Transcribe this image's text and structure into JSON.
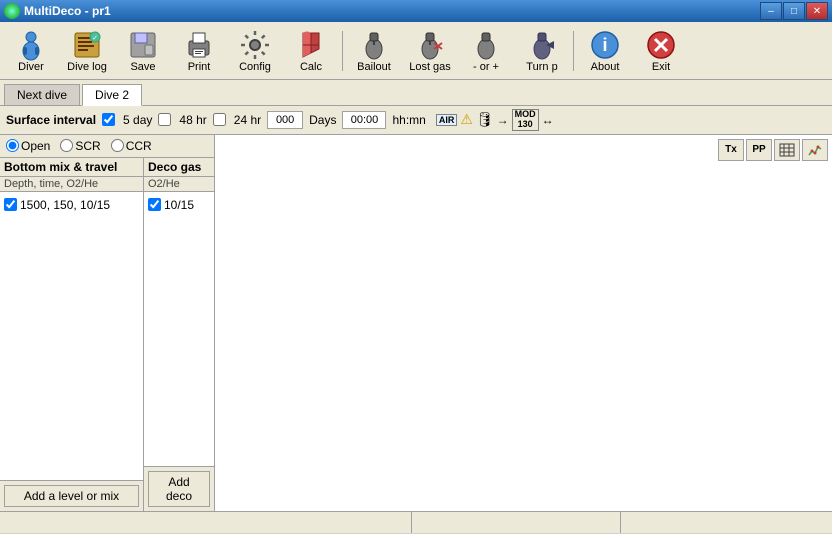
{
  "titlebar": {
    "title": "MultiDeco - pr1",
    "min_label": "–",
    "max_label": "□",
    "close_label": "✕"
  },
  "toolbar": {
    "buttons": [
      {
        "id": "diver",
        "label": "Diver",
        "icon": "👤"
      },
      {
        "id": "divelog",
        "label": "Dive log",
        "icon": "📋"
      },
      {
        "id": "save",
        "label": "Save",
        "icon": "💾"
      },
      {
        "id": "print",
        "label": "Print",
        "icon": "🖨"
      },
      {
        "id": "config",
        "label": "Config",
        "icon": "⚙"
      },
      {
        "id": "calc",
        "label": "Calc",
        "icon": "🔧"
      },
      {
        "id": "bailout",
        "label": "Bailout",
        "icon": "⚓"
      },
      {
        "id": "lostgas",
        "label": "Lost gas",
        "icon": "🪣"
      },
      {
        "id": "or_minus",
        "label": "- or +",
        "icon": "➤"
      },
      {
        "id": "turnp",
        "label": "Turn p",
        "icon": "🪣"
      },
      {
        "id": "about",
        "label": "About",
        "icon": "ℹ"
      },
      {
        "id": "exit",
        "label": "Exit",
        "icon": "✕"
      }
    ]
  },
  "tabs": [
    {
      "id": "nextdive",
      "label": "Next dive",
      "active": false
    },
    {
      "id": "dive2",
      "label": "Dive 2",
      "active": true
    }
  ],
  "surface_bar": {
    "label": "Surface interval",
    "checks": [
      {
        "id": "5day",
        "label": "5 day",
        "checked": true
      },
      {
        "id": "48hr",
        "label": "48 hr",
        "checked": false
      },
      {
        "id": "24hr",
        "label": "24 hr",
        "checked": false
      }
    ],
    "days_value": "000",
    "days_label": "Days",
    "time_value": "00:00",
    "time_label": "hh:mn"
  },
  "mode_radios": [
    {
      "id": "open",
      "label": "Open",
      "selected": true
    },
    {
      "id": "scr",
      "label": "SCR",
      "selected": false
    },
    {
      "id": "ccr",
      "label": "CCR",
      "selected": false
    }
  ],
  "bottom_col": {
    "header": "Bottom mix & travel",
    "subheader": "Depth, time, O2/He",
    "items": [
      {
        "checked": true,
        "value": "1500, 150, 10/15"
      }
    ],
    "add_btn": "Add a level or mix"
  },
  "deco_col": {
    "header": "Deco gas",
    "subheader": "O2/He",
    "items": [
      {
        "checked": true,
        "value": "10/15"
      }
    ],
    "add_btn": "Add deco"
  },
  "right_toolbar": {
    "buttons": [
      {
        "id": "tx",
        "label": "Tx"
      },
      {
        "id": "pp",
        "label": "PP"
      },
      {
        "id": "table",
        "label": "⊞"
      },
      {
        "id": "graph",
        "label": "📈"
      }
    ]
  },
  "status_bar": {
    "sections": [
      "",
      "",
      ""
    ]
  },
  "icons": {
    "air": "AIR",
    "warning": "⚠",
    "tank": "🛢",
    "arrow_right": "→",
    "mod": "MOD\n130",
    "arrows": "↔"
  }
}
